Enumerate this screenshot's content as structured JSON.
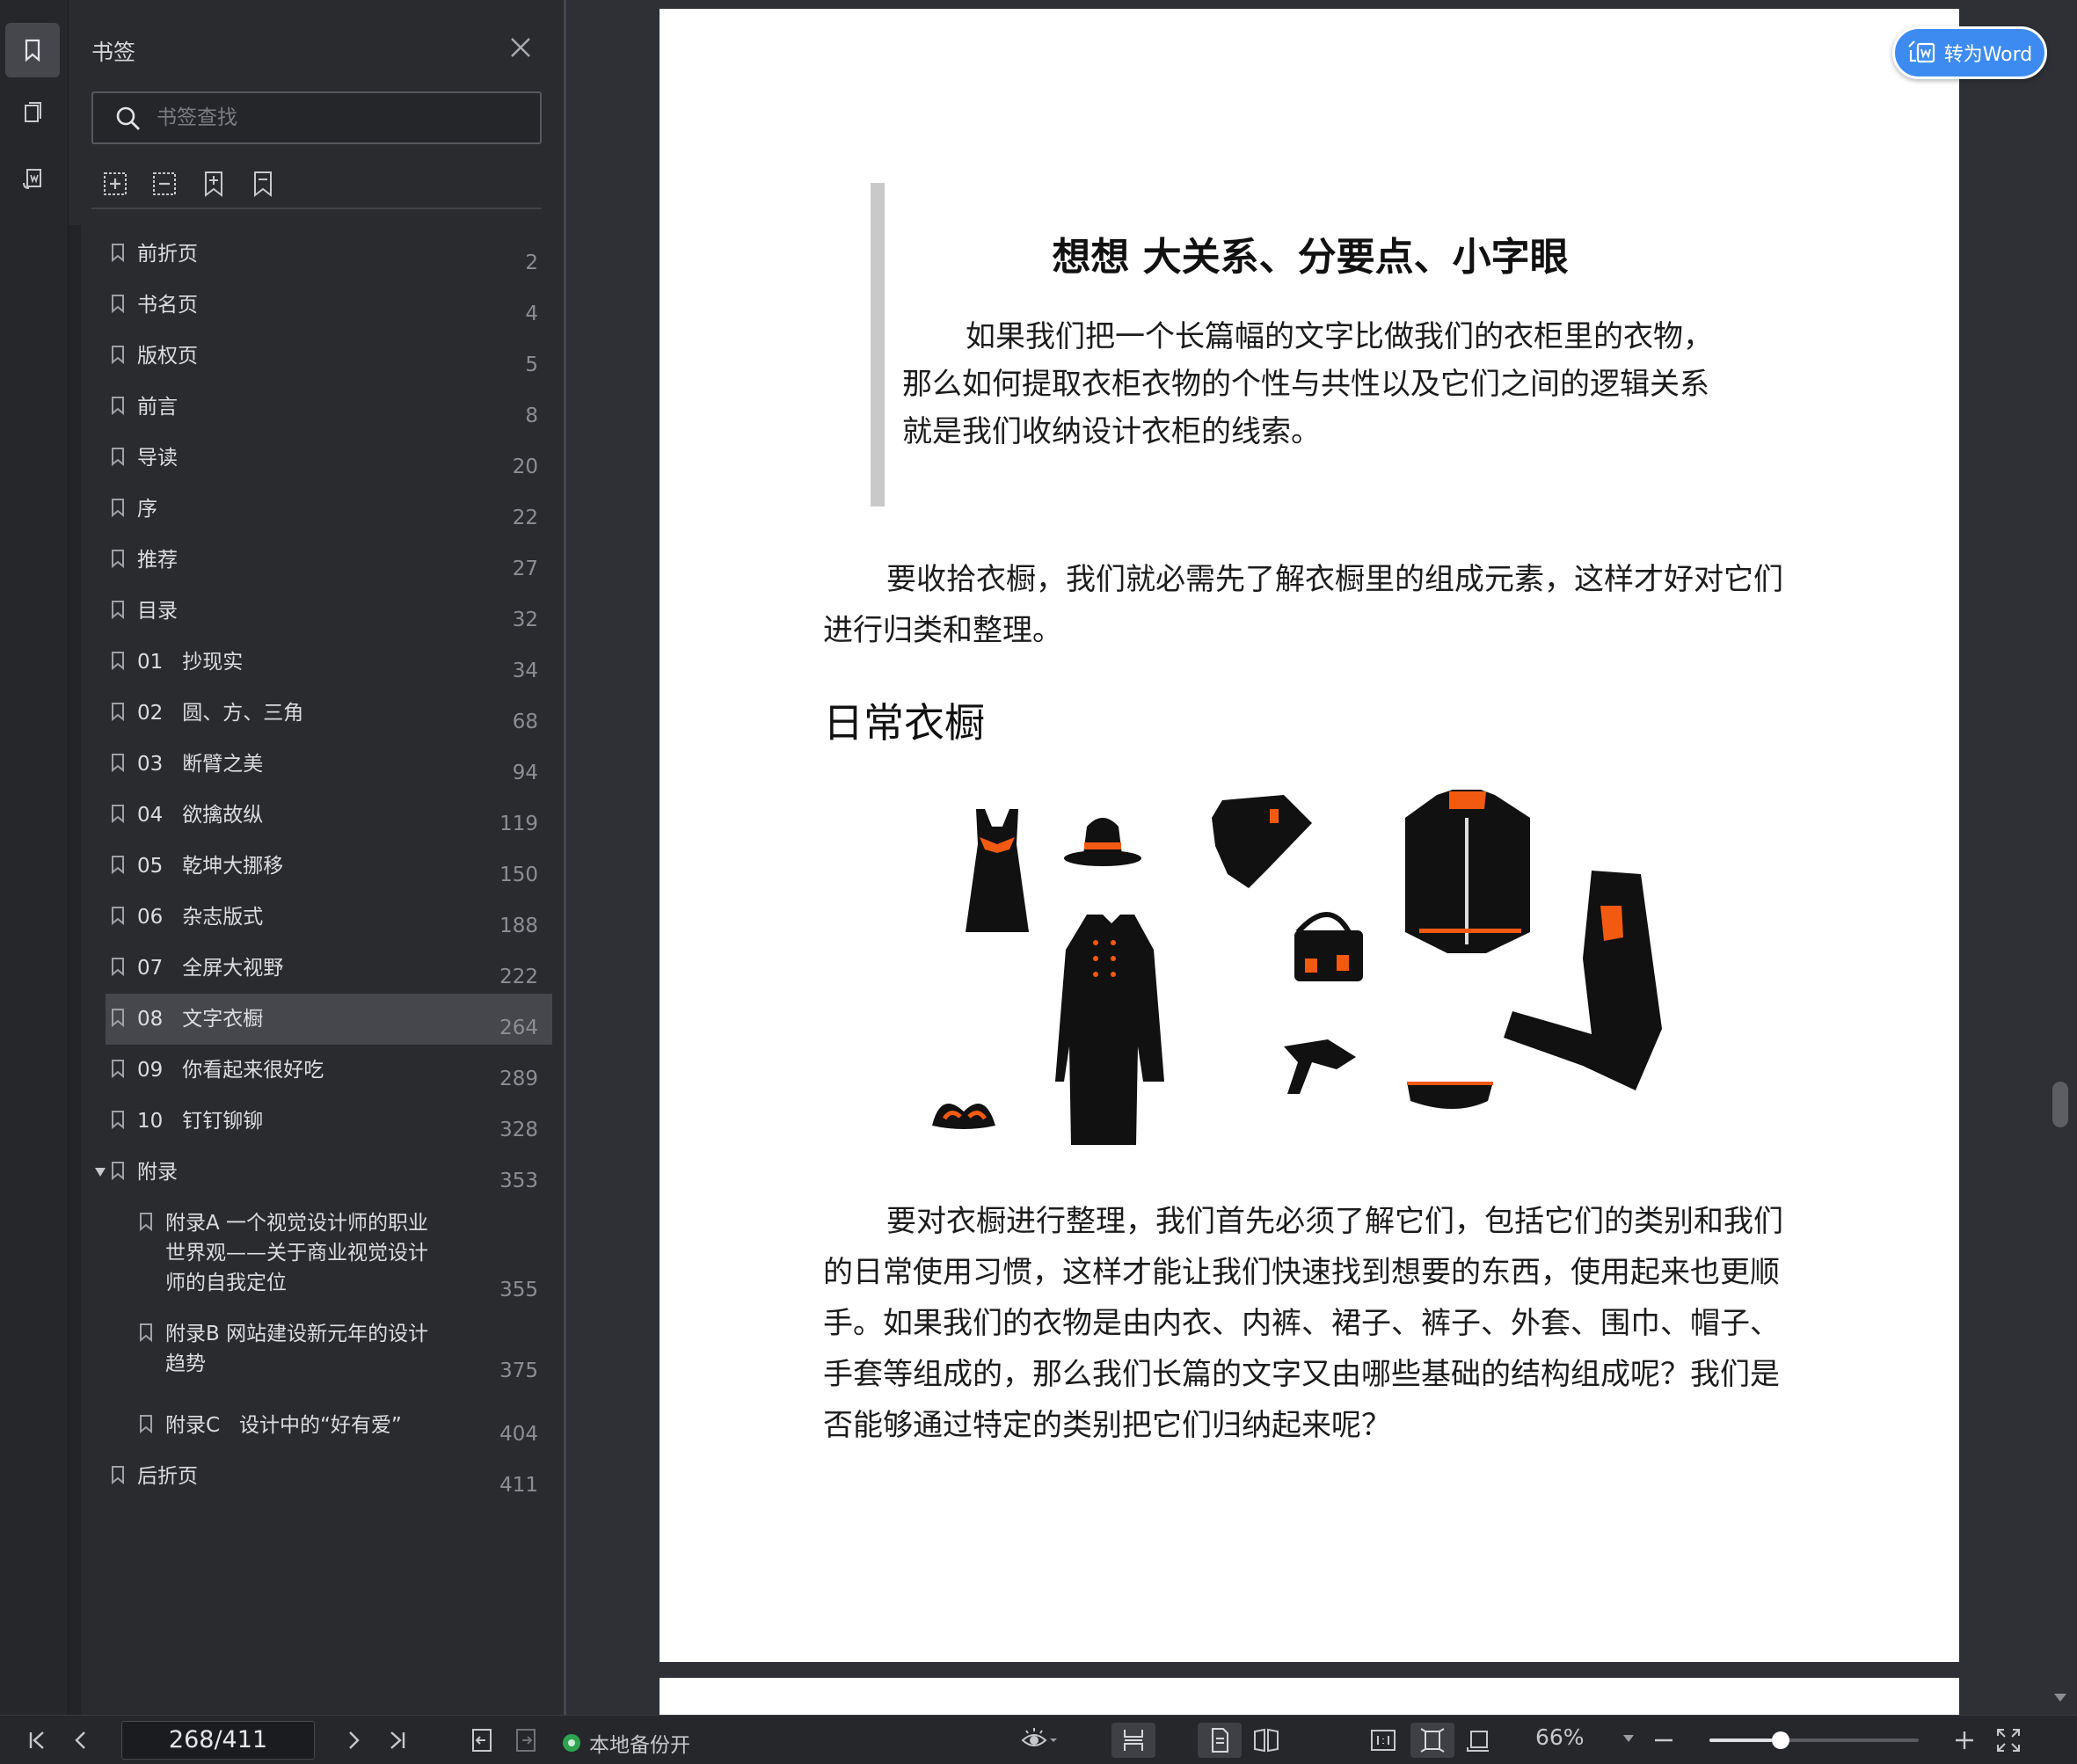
{
  "rail": {
    "icons": [
      "bookmark-icon",
      "thumbnail-icon",
      "export-icon"
    ]
  },
  "panel": {
    "title": "书签",
    "search_placeholder": "书签查找",
    "tools": [
      "expand-all-icon",
      "collapse-all-icon",
      "add-bookmark-icon",
      "bookmark-icon"
    ],
    "items": [
      {
        "label": "前折页",
        "page": "2"
      },
      {
        "label": "书名页",
        "page": "4"
      },
      {
        "label": "版权页",
        "page": "5"
      },
      {
        "label": "前言",
        "page": "8"
      },
      {
        "label": "导读",
        "page": "20"
      },
      {
        "label": "序",
        "page": "22"
      },
      {
        "label": "推荐",
        "page": "27"
      },
      {
        "label": "目录",
        "page": "32"
      },
      {
        "label": "01   抄现实",
        "page": "34"
      },
      {
        "label": "02   圆、方、三角",
        "page": "68"
      },
      {
        "label": "03   断臂之美",
        "page": "94"
      },
      {
        "label": "04   欲擒故纵",
        "page": "119"
      },
      {
        "label": "05   乾坤大挪移",
        "page": "150"
      },
      {
        "label": "06   杂志版式",
        "page": "188"
      },
      {
        "label": "07   全屏大视野",
        "page": "222"
      },
      {
        "label": "08   文字衣橱",
        "page": "264",
        "selected": true
      },
      {
        "label": "09   你看起来很好吃",
        "page": "289"
      },
      {
        "label": "10   钉钉铆铆",
        "page": "328"
      },
      {
        "label": "附录",
        "page": "353",
        "expanded": true
      },
      {
        "label": "附录A   一个视觉设计师的职业世界观——关于商业视觉设计师的自我定位",
        "page": "355",
        "child": true
      },
      {
        "label": "附录B   网站建设新元年的设计趋势",
        "page": "375",
        "child": true
      },
      {
        "label": "附录C   设计中的“好有爱”",
        "page": "404",
        "child": true
      },
      {
        "label": "后折页",
        "page": "411"
      }
    ]
  },
  "document": {
    "convert_button": "转为Word",
    "chapter_title": "想想    大关系、分要点、小字眼",
    "quote": "如果我们把一个长篇幅的文字比做我们的衣柜里的衣物，那么如何提取衣柜衣物的个性与共性以及它们之间的逻辑关系就是我们收纳设计衣柜的线索。",
    "para1": "要收拾衣橱，我们就必需先了解衣橱里的组成元素，这样才好对它们进行归类和整理。",
    "heading": "日常衣橱",
    "para2": "要对衣橱进行整理，我们首先必须了解它们，包括它们的类别和我们的日常使用习惯，这样才能让我们快速找到想要的东西，使用起来也更顺手。如果我们的衣物是由内衣、内裤、裙子、裤子、外套、围巾、帽子、手套等组成的，那么我们长篇的文字又由哪些基础的结构组成呢？我们是否能够通过特定的类别把它们归纳起来呢？",
    "illustration": "clothing-illustration",
    "accent_color": "#f25a12"
  },
  "statusbar": {
    "page_indicator": "268/411",
    "backup_status": "本地备份开",
    "zoom": "66%",
    "zoom_level": 0.34
  }
}
